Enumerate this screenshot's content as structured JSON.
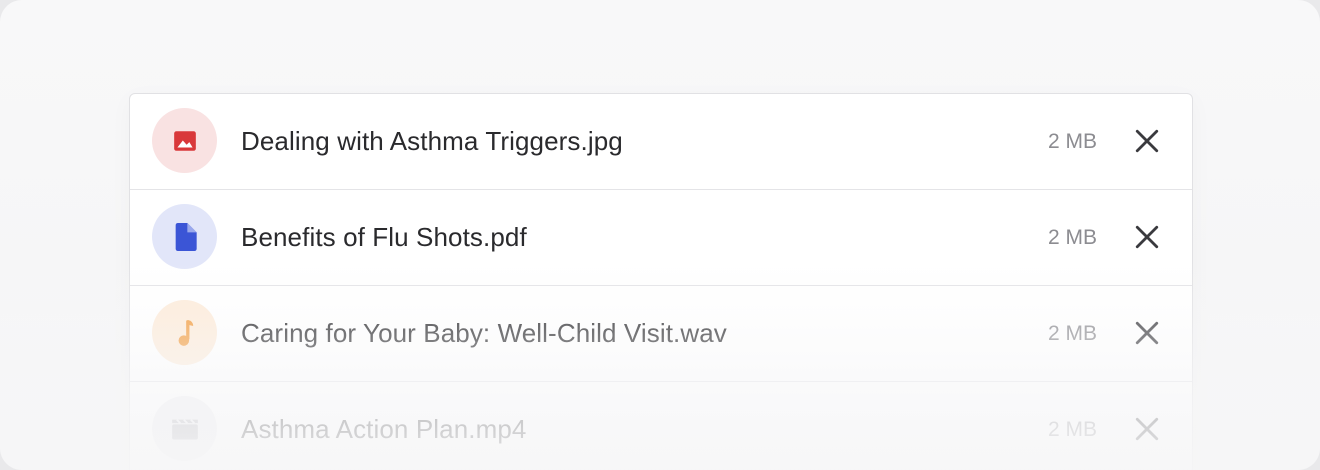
{
  "files": [
    {
      "name": "Dealing with Asthma Triggers.jpg",
      "size": "2 MB",
      "type_icon": "image-icon",
      "icon_color": "#d9383a",
      "icon_bg": "#f9e2e2"
    },
    {
      "name": "Benefits of Flu Shots.pdf",
      "size": "2 MB",
      "type_icon": "document-icon",
      "icon_color": "#3b55d6",
      "icon_bg": "#e2e6f9"
    },
    {
      "name": "Caring for Your Baby: Well-Child Visit.wav",
      "size": "2 MB",
      "type_icon": "music-note-icon",
      "icon_color": "#f29a3b",
      "icon_bg": "#fdebd9"
    },
    {
      "name": "Asthma Action Plan.mp4",
      "size": "2 MB",
      "type_icon": "video-icon",
      "icon_color": "#a8a8b0",
      "icon_bg": "#ececef"
    }
  ],
  "remove_icon": "close-icon"
}
